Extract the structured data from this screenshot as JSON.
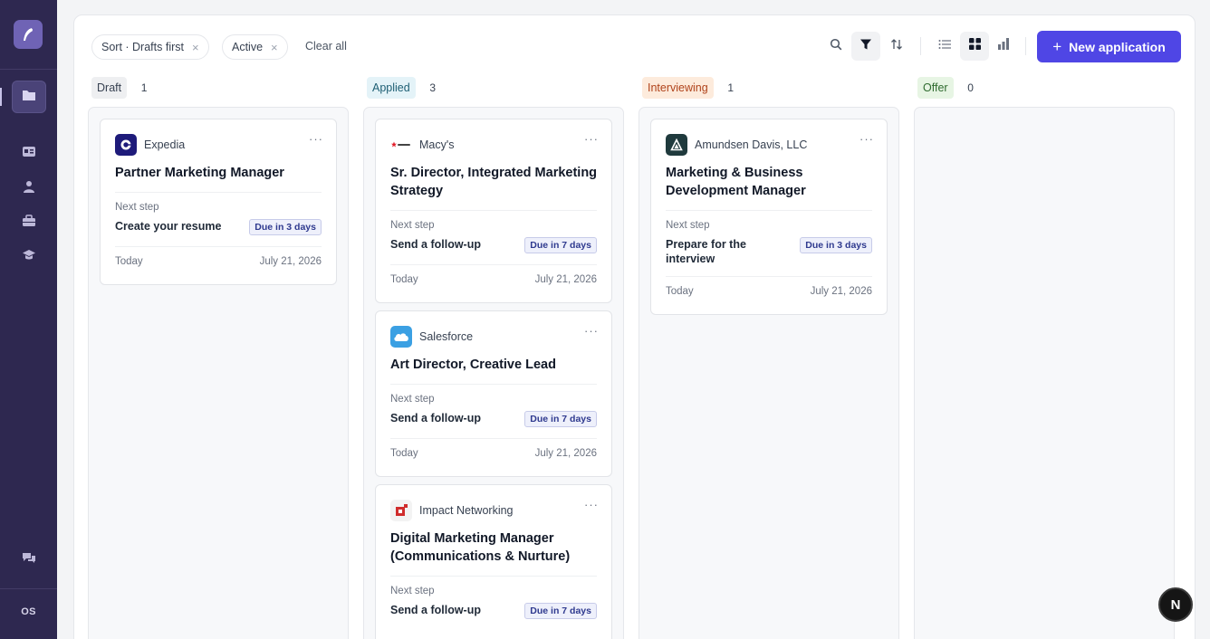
{
  "sidebar": {
    "icons": [
      "logo-quill-icon",
      "folder-icon",
      "id-card-icon",
      "person-icon",
      "briefcase-icon",
      "graduation-cap-icon",
      "feedback-chat-icon"
    ],
    "user_initials": "OS"
  },
  "toolbar": {
    "chips": [
      {
        "label": "Sort · Drafts first",
        "remove": "×"
      },
      {
        "label": "Active",
        "remove": "×"
      }
    ],
    "clear_all": "Clear all",
    "new_application": "New application",
    "new_application_icon": "+"
  },
  "columns": [
    {
      "label": "Draft",
      "count": "1",
      "color": "#374151",
      "bg": "#eeeff1"
    },
    {
      "label": "Applied",
      "count": "3",
      "color": "#1e5f74",
      "bg": "#e4f3f8"
    },
    {
      "label": "Interviewing",
      "count": "1",
      "color": "#b0431b",
      "bg": "#fdebdc"
    },
    {
      "label": "Offer",
      "count": "0",
      "color": "#2f6b2f",
      "bg": "#e7f5e4"
    }
  ],
  "cards": {
    "expedia": {
      "company": "Expedia",
      "title": "Partner Marketing Manager",
      "next_label": "Next step",
      "next_value": "Create your resume",
      "due": "Due in 3 days",
      "created": "Today",
      "date": "July 21, 2026"
    },
    "macys": {
      "company": "Macy's",
      "title": "Sr. Director, Integrated Marketing Strategy",
      "next_label": "Next step",
      "next_value": "Send a follow-up",
      "due": "Due in 7 days",
      "created": "Today",
      "date": "July 21, 2026"
    },
    "salesforce": {
      "company": "Salesforce",
      "title": "Art Director, Creative Lead",
      "next_label": "Next step",
      "next_value": "Send a follow-up",
      "due": "Due in 7 days",
      "created": "Today",
      "date": "July 21, 2026"
    },
    "impact": {
      "company": "Impact Networking",
      "title": "Digital Marketing Manager (Communications & Nurture)",
      "next_label": "Next step",
      "next_value": "Send a follow-up",
      "due": "Due in 7 days"
    },
    "amundsen": {
      "company": "Amundsen Davis, LLC",
      "title": "Marketing & Business Development Manager",
      "next_label": "Next step",
      "next_value": "Prepare for the interview",
      "due": "Due in 3 days",
      "created": "Today",
      "date": "July 21, 2026"
    }
  },
  "more_glyph": "···",
  "assistant_button": "N",
  "colors": {
    "accent": "#4f46e5",
    "sidebar": "#2e2850"
  }
}
